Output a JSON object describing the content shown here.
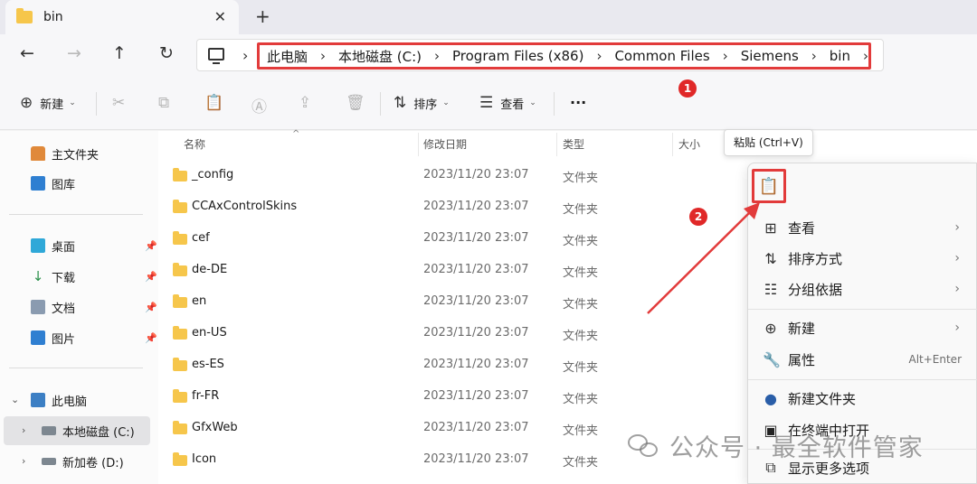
{
  "tab": {
    "title": "bin",
    "close": "✕",
    "new_tab": "+"
  },
  "nav": {
    "back": "←",
    "forward": "→",
    "up": "↑",
    "refresh": "↻",
    "more": "›"
  },
  "breadcrumb": [
    "此电脑",
    "本地磁盘 (C:)",
    "Program Files (x86)",
    "Common Files",
    "Siemens",
    "bin"
  ],
  "breadcrumb_sep": "›",
  "toolbar": {
    "new_label": "新建",
    "sort_label": "排序",
    "view_label": "查看",
    "more": "···"
  },
  "annotations": {
    "marker1": "1",
    "marker2": "2",
    "color": "#e23b3b"
  },
  "columns": {
    "name": "名称",
    "date": "修改日期",
    "type": "类型",
    "size": "大小"
  },
  "files": [
    {
      "name": "_config",
      "date": "2023/11/20 23:07",
      "type": "文件夹"
    },
    {
      "name": "CCAxControlSkins",
      "date": "2023/11/20 23:07",
      "type": "文件夹"
    },
    {
      "name": "cef",
      "date": "2023/11/20 23:07",
      "type": "文件夹"
    },
    {
      "name": "de-DE",
      "date": "2023/11/20 23:07",
      "type": "文件夹"
    },
    {
      "name": "en",
      "date": "2023/11/20 23:07",
      "type": "文件夹"
    },
    {
      "name": "en-US",
      "date": "2023/11/20 23:07",
      "type": "文件夹"
    },
    {
      "name": "es-ES",
      "date": "2023/11/20 23:07",
      "type": "文件夹"
    },
    {
      "name": "fr-FR",
      "date": "2023/11/20 23:07",
      "type": "文件夹"
    },
    {
      "name": "GfxWeb",
      "date": "2023/11/20 23:07",
      "type": "文件夹"
    },
    {
      "name": "Icon",
      "date": "2023/11/20 23:07",
      "type": "文件夹"
    }
  ],
  "sidebar": {
    "home": "主文件夹",
    "gallery": "图库",
    "desktop": "桌面",
    "downloads": "下载",
    "documents": "文档",
    "pictures": "图片",
    "this_pc": "此电脑",
    "local_disk": "本地磁盘 (C:)",
    "new_volume": "新加卷 (D:)"
  },
  "tooltip": "粘贴 (Ctrl+V)",
  "context_menu": {
    "view": "查看",
    "sort_by": "排序方式",
    "group_by": "分组依据",
    "new": "新建",
    "properties": "属性",
    "properties_accel": "Alt+Enter",
    "new_folder": "新建文件夹",
    "open_terminal": "在终端中打开",
    "show_more": "显示更多选项"
  },
  "watermark": "公众号 · 最全软件管家"
}
